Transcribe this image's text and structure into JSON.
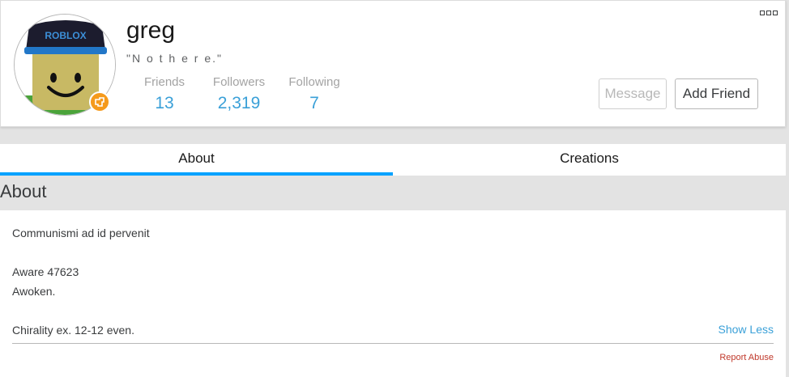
{
  "profile": {
    "username": "greg",
    "status": "\"N o t h e r e.\"",
    "stats": [
      {
        "label": "Friends",
        "value": "13"
      },
      {
        "label": "Followers",
        "value": "2,319"
      },
      {
        "label": "Following",
        "value": "7"
      }
    ],
    "avatar_cap_text": "ROBLOX",
    "buttons": {
      "message": "Message",
      "add_friend": "Add Friend"
    }
  },
  "tabs": [
    {
      "label": "About",
      "active": true
    },
    {
      "label": "Creations",
      "active": false
    }
  ],
  "about": {
    "title": "About",
    "lines": [
      "Communismi ad id pervenit",
      "Aware 47623",
      "Awoken.",
      "Chirality ex. 12-12 even."
    ],
    "show_less": "Show Less",
    "report_abuse": "Report Abuse"
  },
  "colors": {
    "accent": "#00a2ff",
    "link": "#3aa0d8",
    "premium_badge": "#f59a1c",
    "report": "#c0392b"
  },
  "icons": {
    "more": "more-options-icon",
    "premium": "premium-badge-icon"
  }
}
